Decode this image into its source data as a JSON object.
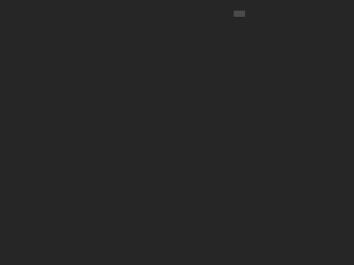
{
  "page": {
    "hint_text": "",
    "button_label": ""
  },
  "colors": {
    "background": "#262626",
    "button_bg": "#4a4a4a",
    "button_text": "#e6e6e6",
    "hint_text": "#9a9a9a"
  }
}
